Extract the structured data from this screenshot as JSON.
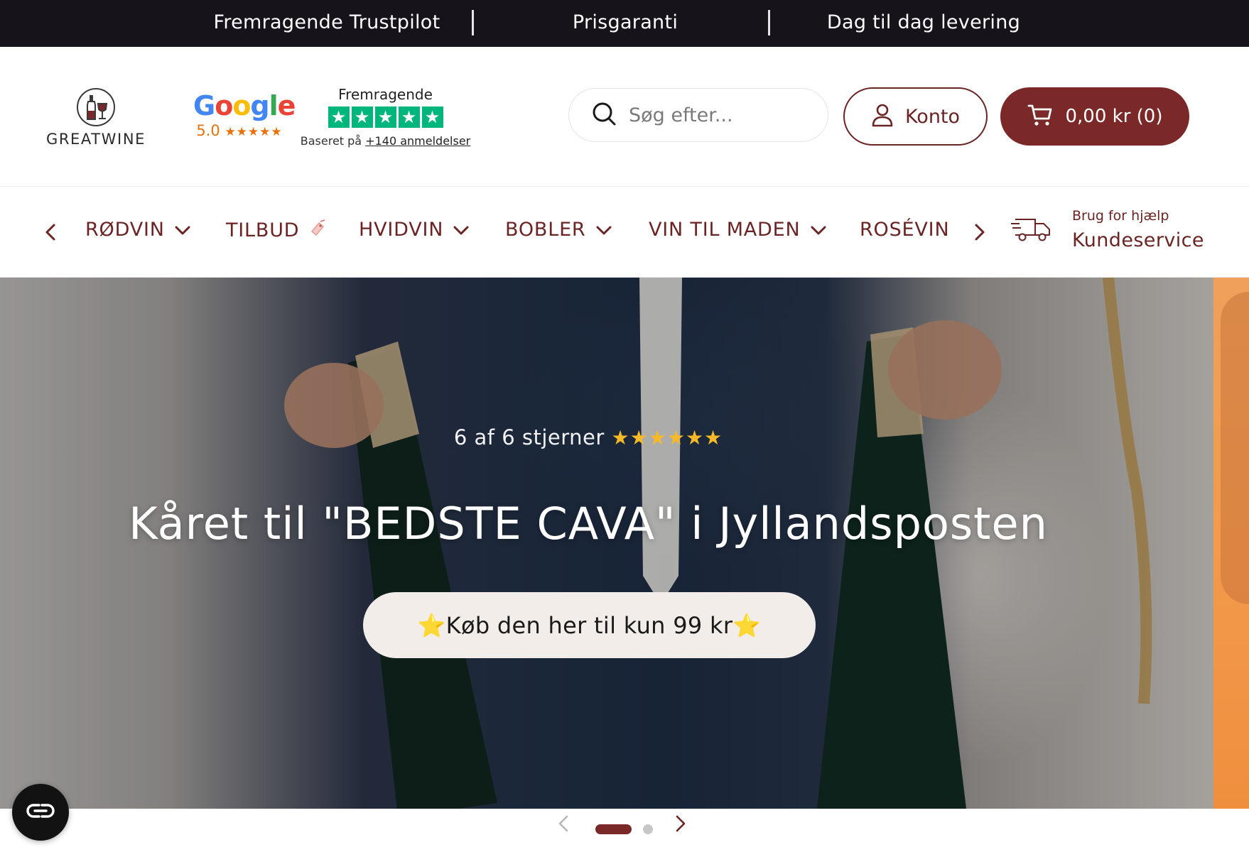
{
  "topbar": {
    "items": [
      "Fremragende Trustpilot",
      "Prisgaranti",
      "Dag til dag levering"
    ]
  },
  "header": {
    "logo_text": "GREATWINE",
    "google": {
      "word_letters": [
        "G",
        "o",
        "o",
        "g",
        "l",
        "e"
      ],
      "rating": "5.0",
      "stars": "★★★★★"
    },
    "trustpilot": {
      "title": "Fremragende",
      "star_glyph": "★",
      "note_prefix": "Baseret på ",
      "note_link": "+140 anmeldelser"
    },
    "search": {
      "placeholder": "Søg efter..."
    },
    "account_label": "Konto",
    "cart_label": "0,00 kr (0)"
  },
  "nav": {
    "items": [
      {
        "label": "RØDVIN",
        "has_dropdown": true
      },
      {
        "label": "TILBUD",
        "has_dropdown": false,
        "icon": "tag-icon"
      },
      {
        "label": "HVIDVIN",
        "has_dropdown": true
      },
      {
        "label": "BOBLER",
        "has_dropdown": true
      },
      {
        "label": "VIN TIL MADEN",
        "has_dropdown": true
      },
      {
        "label": "ROSÉVIN",
        "has_dropdown": false
      }
    ],
    "help_sub": "Brug for hjælp",
    "help_main": "Kundeservice"
  },
  "hero": {
    "rating_text": "6 af 6 stjerner ",
    "rating_stars": "★★★★★★",
    "title": "Kåret til \"BEDSTE CAVA\" i Jyllandsposten",
    "cta": "⭐Køb den her til kun 99 kr⭐"
  },
  "carousel": {
    "slide_count": 2,
    "active_index": 0
  },
  "colors": {
    "brand": "#7a2828",
    "topbar": "#16141a",
    "trustpilot_green": "#00b67a",
    "star_gold": "#f7b928"
  }
}
